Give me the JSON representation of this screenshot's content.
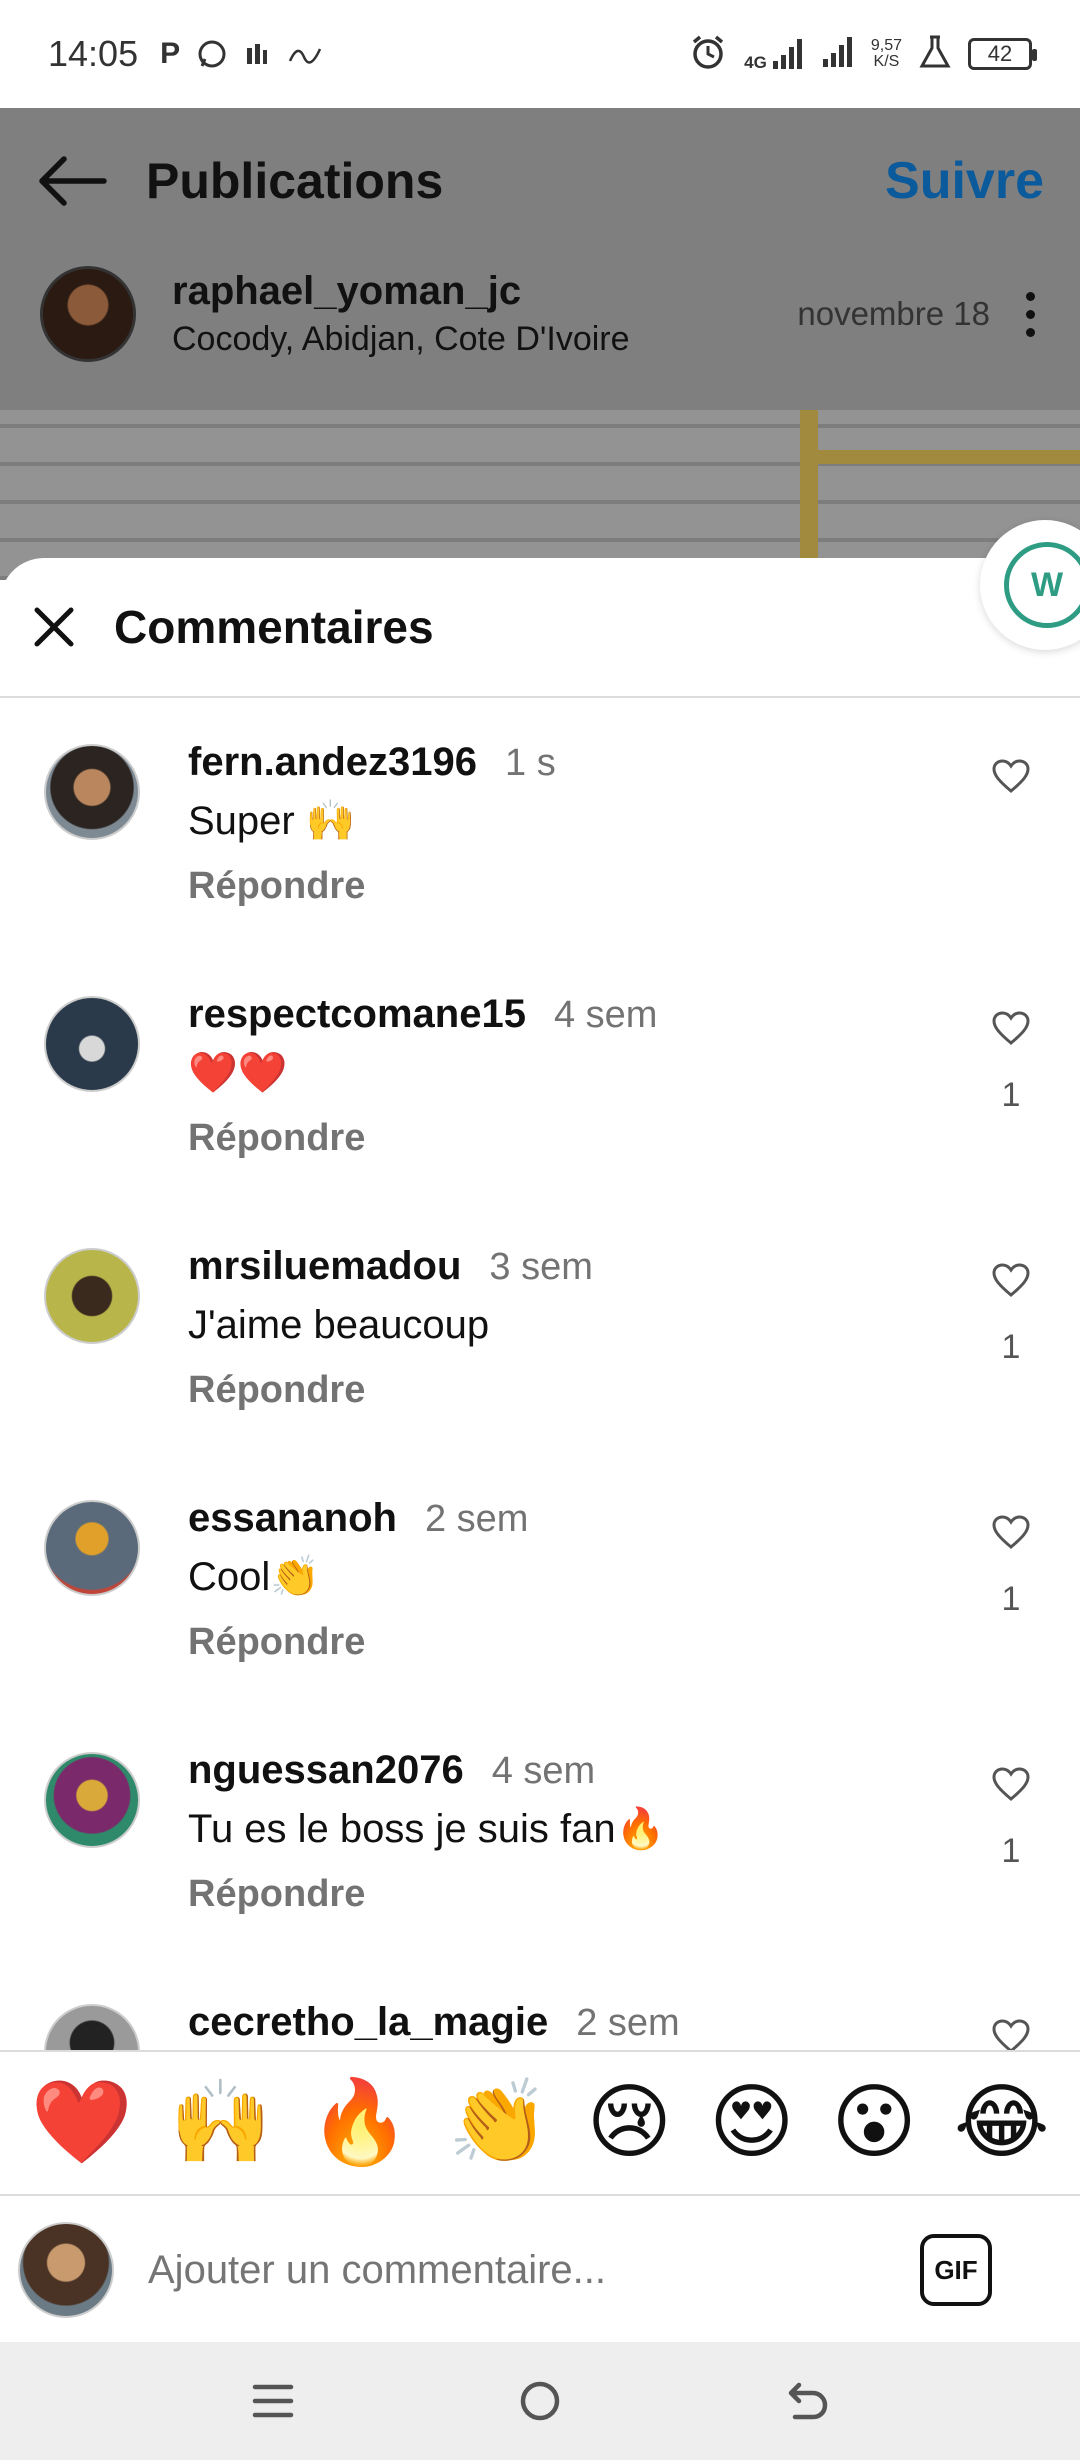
{
  "status_bar": {
    "time": "14:05",
    "network": "4G",
    "speed_value": "9,57",
    "speed_unit": "K/S",
    "battery": "42"
  },
  "header": {
    "title": "Publications",
    "follow_label": "Suivre"
  },
  "post": {
    "username": "raphael_yoman_jc",
    "location": "Cocody, Abidjan, Cote D'Ivoire",
    "date": "novembre 18"
  },
  "comments_sheet": {
    "title": "Commentaires",
    "reply_label": "Répondre",
    "items": [
      {
        "username": "fern.andez3196",
        "time": "1 s",
        "text": "Super 🙌",
        "likes": ""
      },
      {
        "username": "respectcomane15",
        "time": "4 sem",
        "text": "❤️❤️",
        "likes": "1"
      },
      {
        "username": "mrsiluemadou",
        "time": "3 sem",
        "text": "J'aime beaucoup",
        "likes": "1"
      },
      {
        "username": "essananoh",
        "time": "2 sem",
        "text": "Cool👏",
        "likes": "1"
      },
      {
        "username": "nguessan2076",
        "time": "4 sem",
        "text": "Tu es le boss je suis fan🔥",
        "likes": "1"
      },
      {
        "username": "cecretho_la_magie",
        "time": "2 sem",
        "text": "",
        "likes": ""
      }
    ]
  },
  "emoji_bar": [
    "❤️",
    "🙌",
    "🔥",
    "👏",
    "😢",
    "😍",
    "😮",
    "😂"
  ],
  "comment_input": {
    "placeholder": "Ajouter un commentaire...",
    "gif_label": "GIF"
  },
  "colors": {
    "accent": "#0a5a9c",
    "muted_text": "#737373",
    "overlay": "#7f7f7f"
  }
}
